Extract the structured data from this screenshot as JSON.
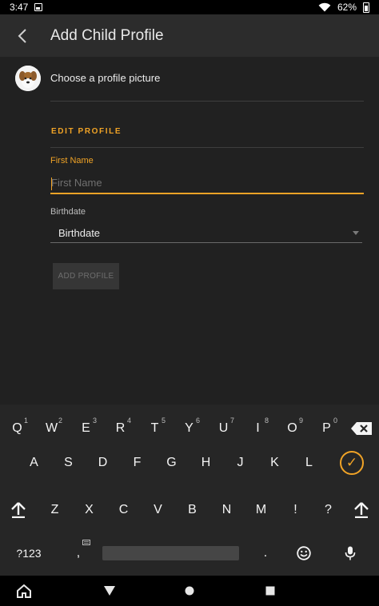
{
  "status_bar": {
    "time": "3:47",
    "battery_percent": "62%"
  },
  "app_bar": {
    "title": "Add Child Profile"
  },
  "profile_picture": {
    "label": "Choose a profile picture"
  },
  "form": {
    "section_title": "EDIT PROFILE",
    "first_name": {
      "label": "First Name",
      "placeholder": "First Name",
      "value": ""
    },
    "birthdate": {
      "label": "Birthdate",
      "value": "Birthdate"
    },
    "add_button_label": "ADD PROFILE"
  },
  "keyboard": {
    "row1": [
      {
        "key": "Q",
        "hint": "1"
      },
      {
        "key": "W",
        "hint": "2"
      },
      {
        "key": "E",
        "hint": "3"
      },
      {
        "key": "R",
        "hint": "4"
      },
      {
        "key": "T",
        "hint": "5"
      },
      {
        "key": "Y",
        "hint": "6"
      },
      {
        "key": "U",
        "hint": "7"
      },
      {
        "key": "I",
        "hint": "8"
      },
      {
        "key": "O",
        "hint": "9"
      },
      {
        "key": "P",
        "hint": "0"
      }
    ],
    "row2": [
      "A",
      "S",
      "D",
      "F",
      "G",
      "H",
      "J",
      "K",
      "L"
    ],
    "row3": [
      "Z",
      "X",
      "C",
      "V",
      "B",
      "N",
      "M",
      "!",
      "?"
    ],
    "symbols_label": "?123",
    "comma": ",",
    "period": "."
  },
  "colors": {
    "accent": "#f0a326",
    "background": "#212121",
    "app_bar": "#2c2c2c",
    "keyboard": "#262626"
  }
}
